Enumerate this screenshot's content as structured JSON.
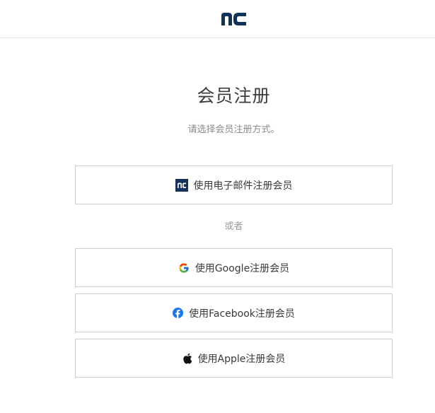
{
  "header": {
    "logo_icon": "nc-logo-icon",
    "brand_color": "#12325c"
  },
  "page": {
    "title": "会员注册",
    "subtitle": "请选择会员注册方式。"
  },
  "options": {
    "email": {
      "label": "使用电子邮件注册会员",
      "icon": "nc-logo-icon"
    },
    "or_text": "或者",
    "google": {
      "label": "使用Google注册会员",
      "icon": "google-icon"
    },
    "facebook": {
      "label": "使用Facebook注册会员",
      "icon": "facebook-icon"
    },
    "apple": {
      "label": "使用Apple注册会员",
      "icon": "apple-icon"
    }
  },
  "colors": {
    "facebook_blue": "#1877f2",
    "border": "#cfcfcf"
  }
}
